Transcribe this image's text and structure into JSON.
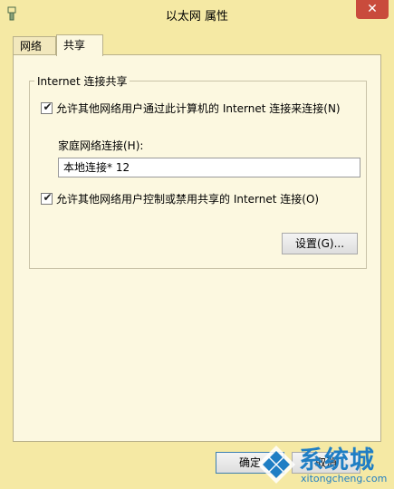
{
  "window": {
    "title": "以太网 属性",
    "close_glyph": "✕"
  },
  "tabs": [
    {
      "label": "网络",
      "active": false
    },
    {
      "label": "共享",
      "active": true
    }
  ],
  "group": {
    "legend": "Internet 连接共享",
    "allow_share": {
      "label": "允许其他网络用户通过此计算机的 Internet 连接来连接(N)",
      "checked": true
    },
    "home_network_label": "家庭网络连接(H):",
    "home_network_value": "本地连接* 12",
    "allow_control": {
      "label": "允许其他网络用户控制或禁用共享的 Internet 连接(O)",
      "checked": true
    },
    "settings_label": "设置(G)..."
  },
  "footer": {
    "ok_label": "确定",
    "cancel_label": "取消"
  },
  "watermark": {
    "text": "系统城",
    "url": "xitongcheng.com"
  },
  "icons": {
    "app": "network-adapter-icon",
    "check": "✔"
  },
  "colors": {
    "window_bg": "#f5e9a4",
    "panel_bg": "#fcf8e0",
    "close_bg": "#c94b3c",
    "accent": "#1f7ec4"
  }
}
